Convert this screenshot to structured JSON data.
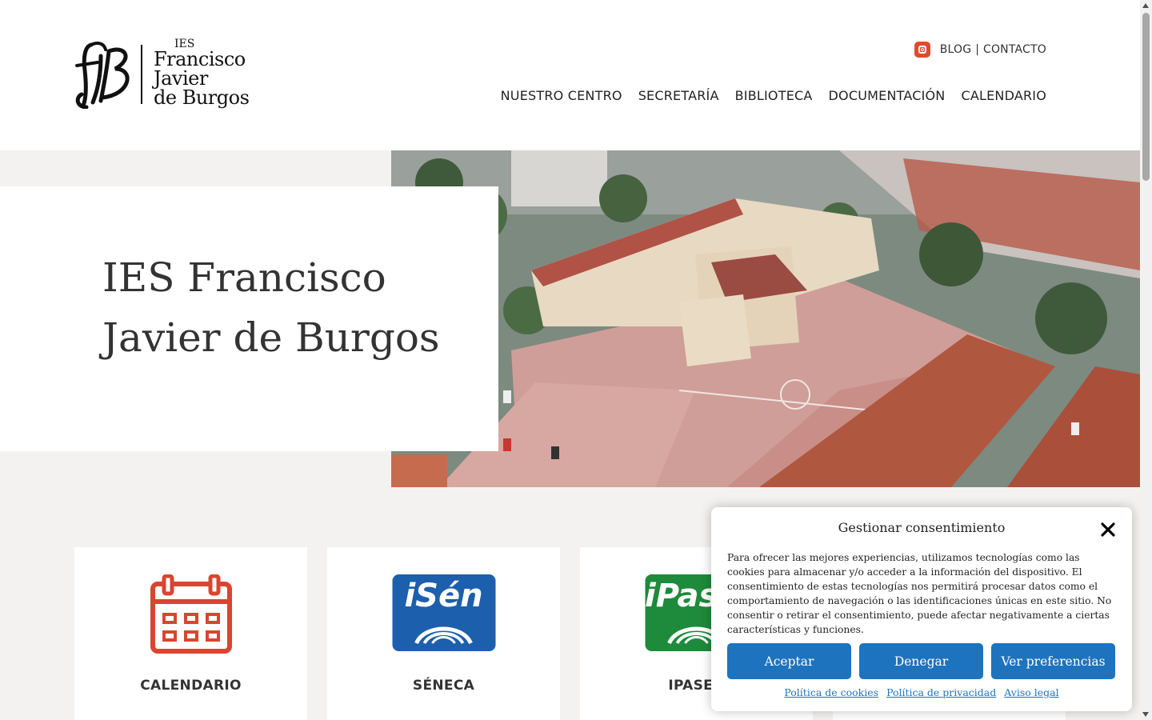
{
  "logo": {
    "small": "IES",
    "line1": "Francisco",
    "line2": "Javier",
    "line3": "de Burgos",
    "mark": "fjB"
  },
  "topbar": {
    "instagram_icon": "instagram-icon",
    "blog": "BLOG",
    "separator": "|",
    "contact": "CONTACTO"
  },
  "nav": {
    "items": [
      "NUESTRO CENTRO",
      "SECRETARÍA",
      "BIBLIOTECA",
      "DOCUMENTACIÓN",
      "CALENDARIO"
    ]
  },
  "hero": {
    "title_line1": "IES Francisco",
    "title_line2": "Javier de Burgos"
  },
  "cards": [
    {
      "label": "CALENDARIO",
      "icon": "calendar-icon",
      "color": "#d9452f"
    },
    {
      "label": "SÉNECA",
      "icon": "isen-app-icon",
      "app_text": "iSén",
      "color": "#1c5fad"
    },
    {
      "label": "IPASEN",
      "icon": "ipasen-app-icon",
      "app_text": "iPasen",
      "color": "#1e8a3b"
    },
    {
      "label": "",
      "icon": "",
      "color": ""
    }
  ],
  "consent": {
    "title": "Gestionar consentimiento",
    "body": "Para ofrecer las mejores experiencias, utilizamos tecnologías como las cookies para almacenar y/o acceder a la información del dispositivo. El consentimiento de estas tecnologías nos permitirá procesar datos como el comportamiento de navegación o las identificaciones únicas en este sitio. No consentir o retirar el consentimiento, puede afectar negativamente a ciertas características y funciones.",
    "accept": "Aceptar",
    "deny": "Denegar",
    "preferences": "Ver preferencias",
    "links": [
      "Política de cookies",
      "Política de privacidad",
      "Aviso legal"
    ],
    "button_color": "#1e73be"
  },
  "colors": {
    "accent": "#e2492d",
    "band": "#f4f2f0"
  }
}
